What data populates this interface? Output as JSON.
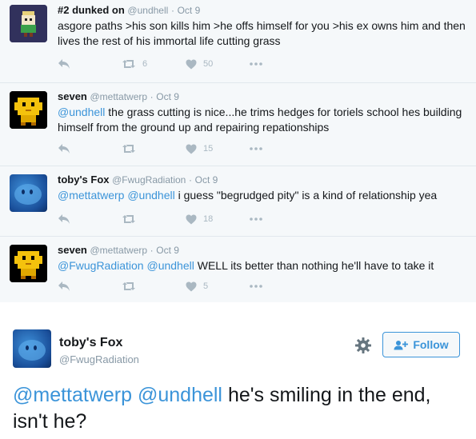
{
  "thread": [
    {
      "fullname": "#2 dunked on",
      "handle": "@undhell",
      "dot": "·",
      "time": "Oct 9",
      "text": "asgore paths >his son kills him >he offs himself for you  >his ex owns him and then lives the rest of his immortal life cutting grass",
      "retweets": "6",
      "likes": "50",
      "avatar": "pixel-sprite-avatar"
    },
    {
      "fullname": "seven",
      "handle": "@mettatwerp",
      "dot": "·",
      "time": "Oct 9",
      "mentions": "@undhell",
      "text": " the grass cutting is nice...he trims hedges for toriels school hes building himself from the ground up and repairing repationships",
      "retweets": "",
      "likes": "15",
      "avatar": "yellow-pixel-avatar"
    },
    {
      "fullname": "toby's Fox",
      "handle": "@FwugRadiation",
      "dot": "·",
      "time": "Oct 9",
      "mentions": "@mettatwerp @undhell",
      "text": " i guess \"begrudged pity\" is a kind of relationship yea",
      "retweets": "",
      "likes": "18",
      "avatar": "blue-creature-avatar"
    },
    {
      "fullname": "seven",
      "handle": "@mettatwerp",
      "dot": "·",
      "time": "Oct 9",
      "mentions": "@FwugRadiation @undhell",
      "text": " WELL its better than nothing he'll have to take it",
      "retweets": "",
      "likes": "5",
      "avatar": "yellow-pixel-avatar"
    }
  ],
  "main_tweet": {
    "fullname": "toby's Fox",
    "handle": "@FwugRadiation",
    "follow_label": "Follow",
    "mentions": "@mettatwerp @undhell",
    "text": " he's smiling in the end, isn't he?",
    "avatar": "blue-creature-avatar"
  },
  "colors": {
    "link": "#3b94d9",
    "muted": "#8899a6",
    "action_icon": "#aab8c2",
    "thread_bg": "#f5f8fa"
  },
  "icons": [
    "reply-icon",
    "retweet-icon",
    "heart-icon",
    "more-icon",
    "gear-icon",
    "follow-person-icon"
  ]
}
